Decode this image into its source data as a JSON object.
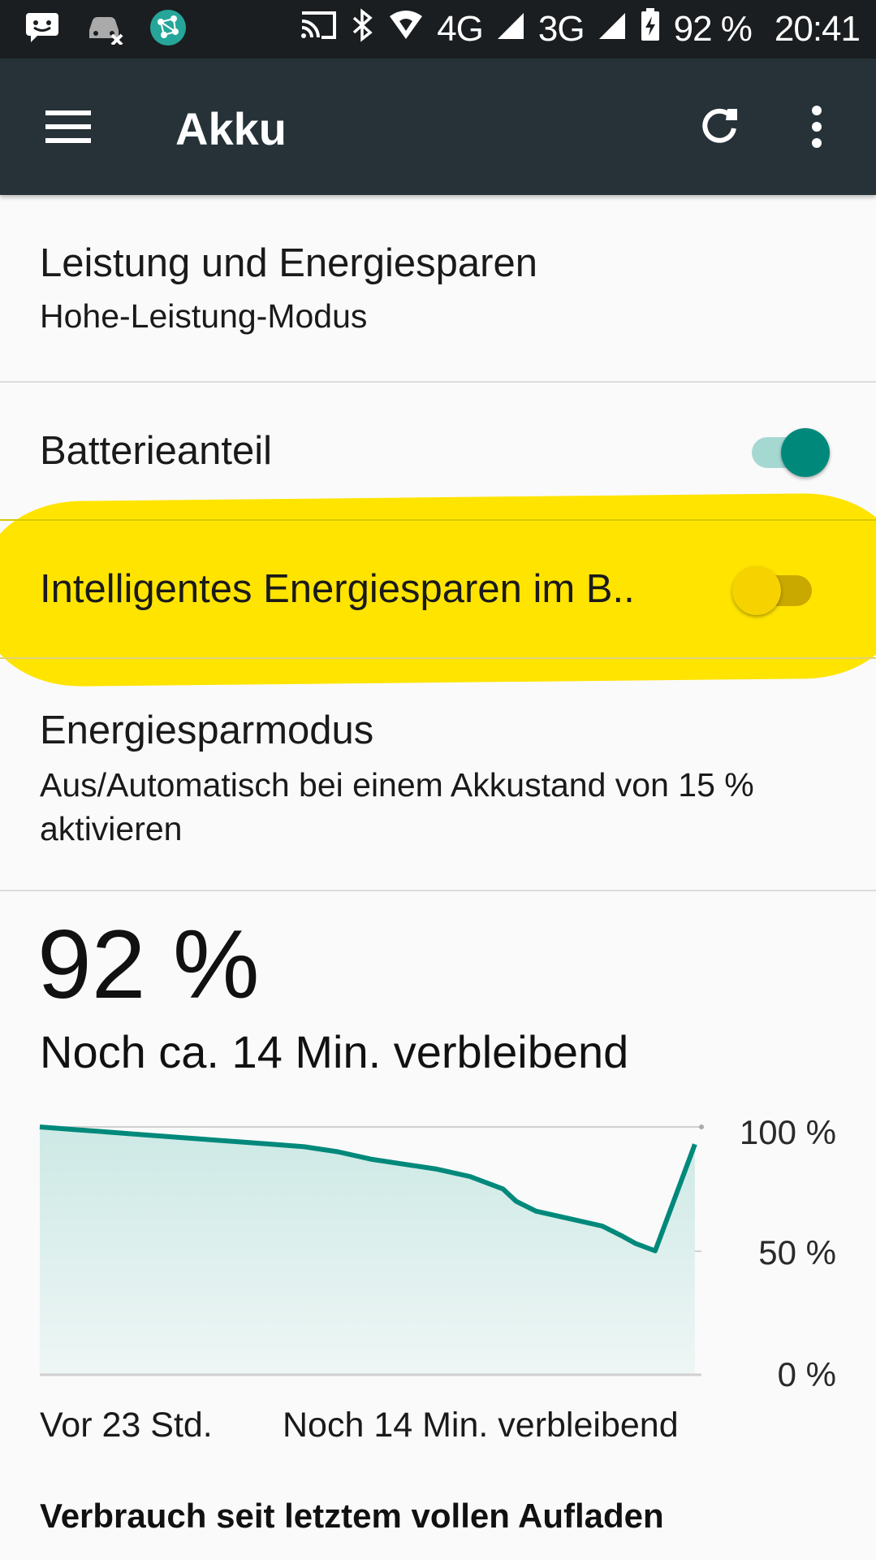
{
  "status_bar": {
    "left_icons": [
      "messenger-icon",
      "car-off-icon",
      "network-app-icon"
    ],
    "network_4g": "4G",
    "network_3g": "3G",
    "battery": "92 %",
    "time": "20:41"
  },
  "app_bar": {
    "title": "Akku"
  },
  "settings": {
    "performance": {
      "title": "Leistung und Energiesparen",
      "subtitle": "Hohe-Leistung-Modus"
    },
    "battery_percentage": {
      "title": "Batterieanteil",
      "enabled": true
    },
    "smart_saving": {
      "title": "Intelligentes Energiesparen im B..",
      "enabled": false
    },
    "power_save_mode": {
      "title": "Energiesparmodus",
      "subtitle": "Aus/Automatisch bei einem Akkustand von 15 % aktivieren"
    }
  },
  "battery": {
    "level": "92 %",
    "remaining": "Noch ca. 14 Min. verbleibend"
  },
  "chart_data": {
    "type": "area",
    "x_start_label": "Vor 23 Std.",
    "x_end_label": "Noch 14 Min. verbleibend",
    "y_tick_labels": [
      "100 %",
      "50 %",
      "0 %"
    ],
    "ylim": [
      0,
      100
    ],
    "x": [
      0,
      0.05,
      0.1,
      0.15,
      0.2,
      0.25,
      0.3,
      0.35,
      0.4,
      0.45,
      0.5,
      0.55,
      0.6,
      0.65,
      0.7,
      0.72,
      0.75,
      0.8,
      0.85,
      0.88,
      0.9,
      0.93,
      0.99
    ],
    "values": [
      100,
      99,
      98,
      97,
      96,
      95,
      94,
      93,
      92,
      90,
      87,
      85,
      83,
      80,
      75,
      70,
      66,
      63,
      60,
      56,
      53,
      50,
      93
    ],
    "accent_color": "#00897b",
    "fill_color": "#d3ece8"
  },
  "footer": {
    "title": "Verbrauch seit letztem vollen Aufladen"
  }
}
